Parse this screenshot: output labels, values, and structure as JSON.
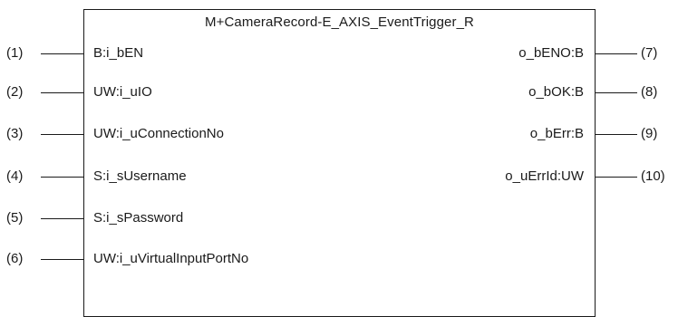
{
  "block": {
    "title": "M+CameraRecord-E_AXIS_EventTrigger_R"
  },
  "inputs": [
    {
      "number": "(1)",
      "label": "B:i_bEN"
    },
    {
      "number": "(2)",
      "label": "UW:i_uIO"
    },
    {
      "number": "(3)",
      "label": "UW:i_uConnectionNo"
    },
    {
      "number": "(4)",
      "label": "S:i_sUsername"
    },
    {
      "number": "(5)",
      "label": "S:i_sPassword"
    },
    {
      "number": "(6)",
      "label": "UW:i_uVirtualInputPortNo"
    }
  ],
  "outputs": [
    {
      "number": "(7)",
      "label": "o_bENO:B"
    },
    {
      "number": "(8)",
      "label": "o_bOK:B"
    },
    {
      "number": "(9)",
      "label": "o_bErr:B"
    },
    {
      "number": "(10)",
      "label": "o_uErrId:UW"
    }
  ]
}
